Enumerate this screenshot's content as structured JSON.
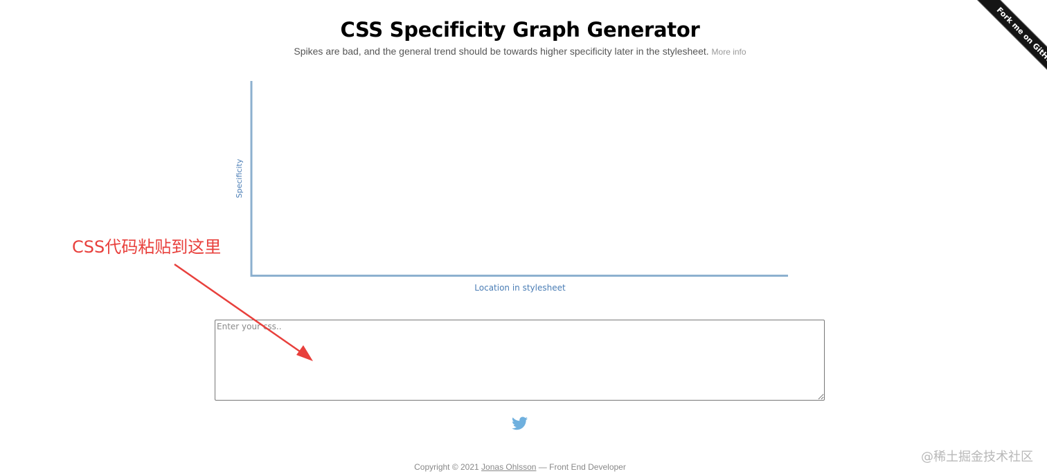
{
  "header": {
    "title": "CSS Specificity Graph Generator",
    "subtitle": "Spikes are bad, and the general trend should be towards higher specificity later in the stylesheet.",
    "more_info_label": "More info"
  },
  "chart_data": {
    "type": "line",
    "xlabel": "Location in stylesheet",
    "ylabel": "Specificity",
    "series": [],
    "axis_color": "#8cb0cf",
    "label_color": "#4a7db5"
  },
  "css_input": {
    "value": "",
    "placeholder": "Enter your css.."
  },
  "annotation": {
    "text": "CSS代码粘贴到这里",
    "color": "#e8403c"
  },
  "share": {
    "icon": "twitter-icon",
    "color": "#6fb0de"
  },
  "footer": {
    "prefix": "Copyright © 2021",
    "author_link": "Jonas Ohlsson",
    "suffix": "— Front End Developer"
  },
  "ribbon": {
    "label": "Fork me on GitHub"
  },
  "watermark": {
    "text": "@稀土掘金技术社区"
  }
}
